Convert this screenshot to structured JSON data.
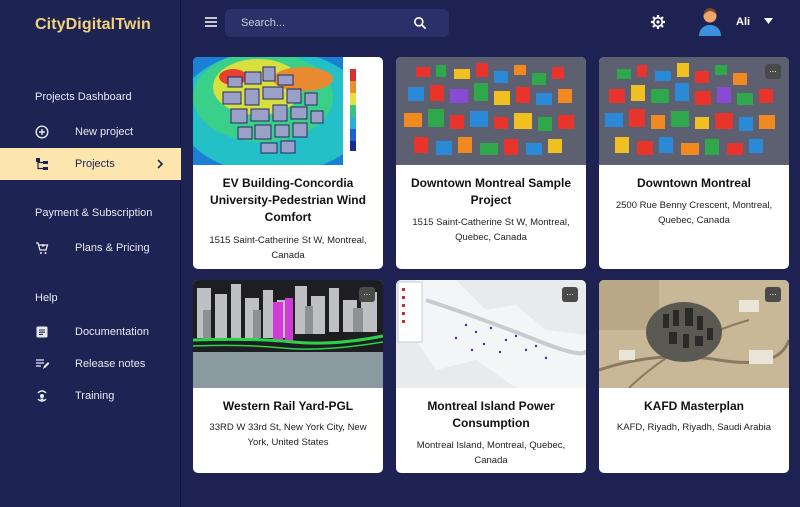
{
  "app": {
    "brand": "CityDigitalTwin"
  },
  "sidebar": {
    "sections": [
      "Projects Dashboard",
      "Payment & Subscription",
      "Help"
    ],
    "items": [
      {
        "label": "New project",
        "icon": "plus-circle-icon"
      },
      {
        "label": "Projects",
        "icon": "projects-tree-icon",
        "active": true
      },
      {
        "label": "Plans & Pricing",
        "icon": "cart-icon"
      },
      {
        "label": "Documentation",
        "icon": "document-icon"
      },
      {
        "label": "Release notes",
        "icon": "notes-edit-icon"
      },
      {
        "label": "Training",
        "icon": "training-icon"
      }
    ]
  },
  "topbar": {
    "search_placeholder": "Search...",
    "user_name": "Ali"
  },
  "projects": [
    {
      "title": "EV Building-Concordia University-Pedestrian Wind Comfort",
      "address": "1515 Saint-Catherine St W, Montreal, Canada",
      "thumb": "wind-map"
    },
    {
      "title": "Downtown Montreal Sample Project",
      "address": "1515 Saint-Catherine St W, Montreal, Quebec, Canada",
      "thumb": "buildings-3d"
    },
    {
      "title": "Downtown Montreal",
      "address": "2500 Rue Benny Crescent, Montreal, Quebec, Canada",
      "thumb": "buildings-3d"
    },
    {
      "title": "Western Rail Yard-PGL",
      "address": "33RD W 33rd St, New York City, New York, United States",
      "thumb": "nyc-3d"
    },
    {
      "title": "Montreal Island Power Consumption",
      "address": "Montreal Island, Montreal, Quebec, Canada",
      "thumb": "power-map"
    },
    {
      "title": "KAFD Masterplan",
      "address": "KAFD, Riyadh, Riyadh, Saudi Arabia",
      "thumb": "satellite"
    }
  ],
  "more_label": "...",
  "colors": {
    "sidebar_bg": "#1d2352",
    "accent": "#f3d27c",
    "active_bg": "#fde6ad",
    "main_bg": "#1e2253"
  }
}
